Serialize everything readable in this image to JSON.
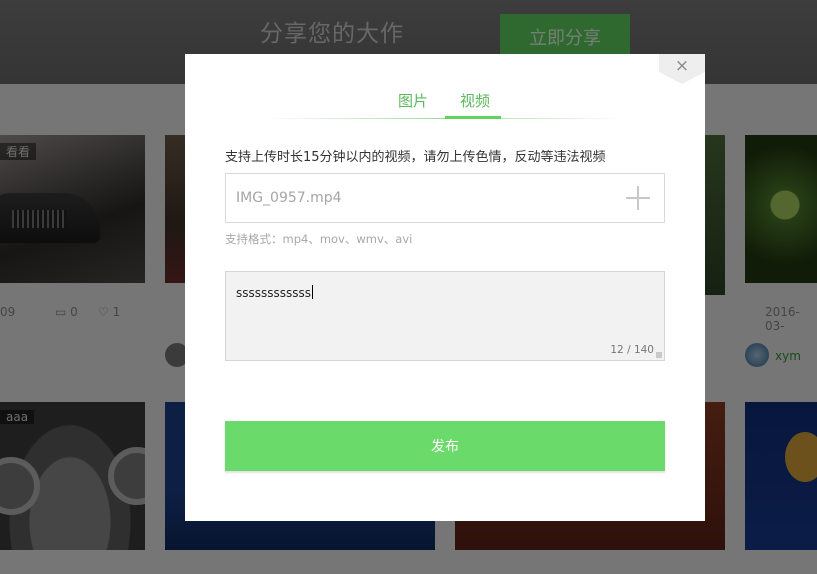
{
  "background": {
    "banner": {
      "title": "分享您的大作",
      "cta": "立即分享"
    },
    "cards": [
      {
        "tag": "看看",
        "date": "09",
        "comments": "0",
        "likes": "1"
      },
      {
        "tag": "aaa"
      }
    ],
    "right_card": {
      "date": "2016-03-",
      "user": "xym"
    }
  },
  "modal": {
    "close_glyph": "×",
    "tabs": [
      {
        "label": "图片",
        "active": false
      },
      {
        "label": "视频",
        "active": true
      }
    ],
    "notice": "支持上传时长15分钟以内的视频，请勿上传色情，反动等违法视频",
    "file": {
      "value": "IMG_0957.mp4"
    },
    "formats_hint": "支持格式：mp4、mov、wmv、avi",
    "description": {
      "value": "ssssssssssss",
      "counter": "12 / 140"
    },
    "publish_label": "发布"
  },
  "colors": {
    "accent": "#5cb85c",
    "button": "#6ada6a"
  }
}
